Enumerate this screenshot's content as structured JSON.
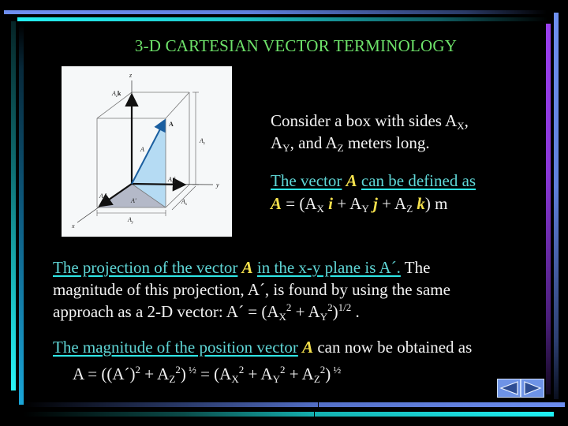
{
  "slide": {
    "title": "3-D CARTESIAN VECTOR TERMINOLOGY",
    "colors": {
      "title": "#6ee36a",
      "body_text": "#f2f2f2",
      "link_text": "#5fd6d6",
      "emphasis": "#f4e04c",
      "background": "#000000"
    }
  },
  "diagram": {
    "labels": {
      "z_axis": "z",
      "y_axis": "y",
      "x_axis": "x",
      "az_k": "A",
      "az_k_sub": "z",
      "az_k_unit": "k",
      "vector_bold": "A",
      "vector_mag": "A",
      "az": "A",
      "az_sub": "z",
      "ay_j": "A",
      "ay_j_sub": "y",
      "ay_j_unit": "j",
      "ax_i": "A",
      "ax_i_sub": "x",
      "ax_i_unit": "i",
      "a_prime": "A'",
      "ax": "A",
      "ax_sub": "x",
      "ay": "A",
      "ay_sub": "y"
    }
  },
  "para1": {
    "line1_text": "Consider a box with sides A",
    "line1_sub": "X",
    "line1_end": ",",
    "line2_a": "A",
    "line2_sub_y": "Y",
    "line2_mid": ", and A",
    "line2_sub_z": "Z",
    "line2_end": " meters long."
  },
  "para2": {
    "link1": "The vector",
    "vec": "A",
    "link2": "can be defined as",
    "eq_vec": "A",
    "eq_a": " = (A",
    "eq_sub_x": "X",
    "eq_i": "i",
    "eq_plus1": " + A",
    "eq_sub_y": "Y",
    "eq_j": "j",
    "eq_plus2": " + A",
    "eq_sub_z": "Z",
    "eq_k": "k",
    "eq_end": ")  m"
  },
  "para3": {
    "link1": "The projection of the vector",
    "vec": "A",
    "link2": "in the x-y plane is A´.",
    "line1_end": "  The",
    "line2": "magnitude of this projection, A´, is found by using the same",
    "line3_a": "approach as a 2-D vector:   A´ = (A",
    "line3_sub_x": "X",
    "line3_sup1": "2",
    "line3_plus": " + A",
    "line3_sub_y": "Y",
    "line3_sup2": "2",
    "line3_close": ")",
    "line3_sup3": "1/2",
    "line3_end": " ."
  },
  "para4": {
    "link1": "The magnitude of the position vector",
    "vec": "A",
    "line1_end": " can now be obtained as",
    "eq_a": "A  = ((A´)",
    "eq_sup1": "2",
    "eq_plus1": " + A",
    "eq_sub_z1": "Z",
    "eq_sup2": "2",
    "eq_close1": ")",
    "eq_half1": " ½",
    "eq_eq": "  =   (A",
    "eq_sub_x": "X",
    "eq_sup3": "2",
    "eq_plus2": " + A",
    "eq_sub_y": "Y",
    "eq_sup4": "2",
    "eq_plus3": " + A",
    "eq_sub_z2": "Z",
    "eq_sup5": "2",
    "eq_close2": ")",
    "eq_half2": " ½"
  },
  "navigation": {
    "previous_icon": "triangle-left-icon",
    "next_icon": "triangle-right-icon"
  }
}
